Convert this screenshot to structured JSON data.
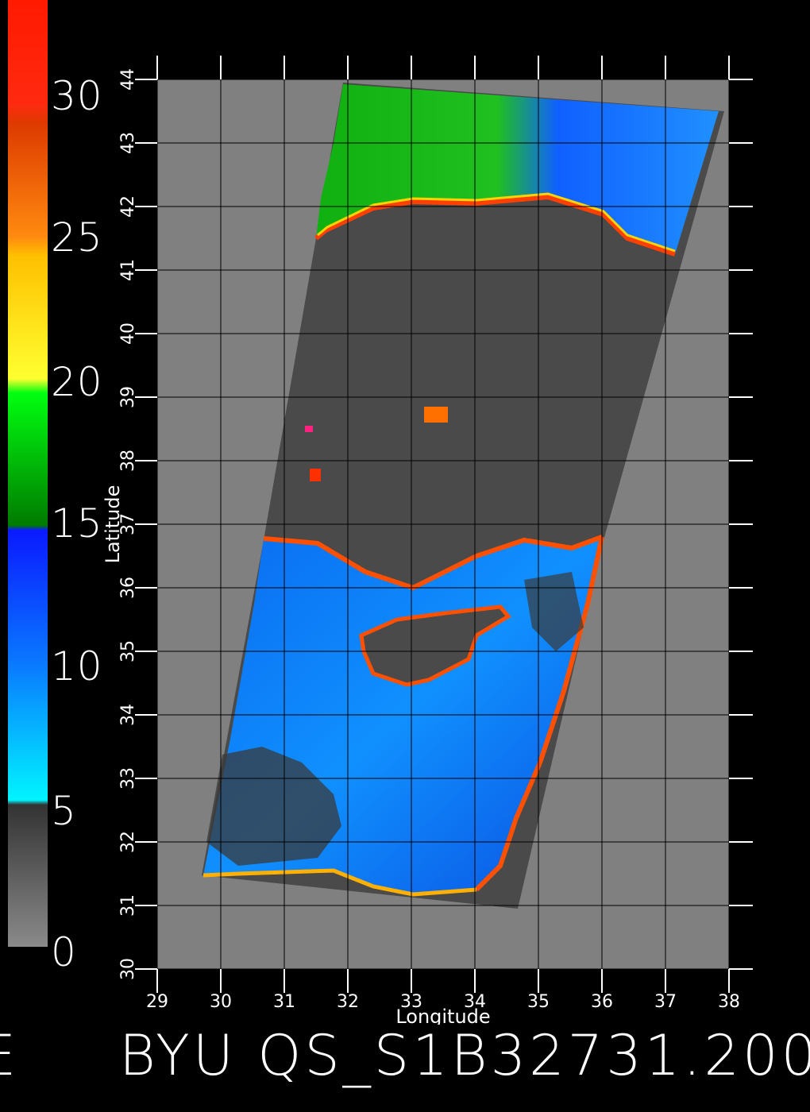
{
  "colorbar": {
    "labels": [
      "30",
      "25",
      "20",
      "15",
      "10",
      "5",
      "0"
    ],
    "colors": {
      "red": "#ff1a00",
      "orange": "#ff8a10",
      "yellow": "#ffd400",
      "green": "#00c800",
      "darkgreen": "#007a00",
      "blue": "#0a28ff",
      "cyan": "#00f0ff",
      "darkgray": "#333333",
      "gray": "#8a8a8a"
    }
  },
  "map": {
    "xlabel": "Longitude",
    "ylabel": "Latitude",
    "lon_ticks": [
      "29",
      "30",
      "31",
      "32",
      "33",
      "34",
      "35",
      "36",
      "37",
      "38"
    ],
    "lat_ticks": [
      "30",
      "31",
      "32",
      "33",
      "34",
      "35",
      "36",
      "37",
      "38",
      "39",
      "40",
      "41",
      "42",
      "43",
      "44"
    ],
    "lon_range": [
      29,
      38
    ],
    "lat_range": [
      30,
      44
    ],
    "background": "#808080",
    "land_color": "#4a4a4a"
  },
  "title": "BYU  QS_S1B32731.200",
  "left_fragment": "E"
}
